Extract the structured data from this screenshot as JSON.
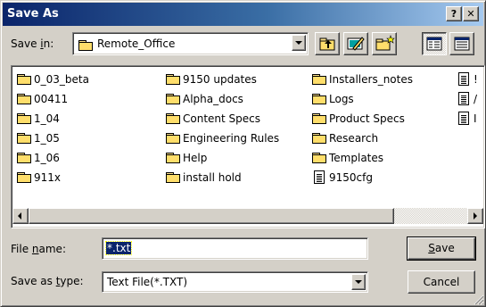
{
  "window": {
    "title": "Save As"
  },
  "titlebar": {
    "help_label": "?",
    "close_label": "✕"
  },
  "save_in": {
    "label_pre": "Save ",
    "label_key": "i",
    "label_post": "n:",
    "value": "Remote_Office"
  },
  "toolbar": {
    "up_folder_icon": "up-one-level-icon",
    "desktop_icon": "desktop-icon",
    "new_folder_icon": "new-folder-icon",
    "list_view_icon": "list-view-icon",
    "details_view_icon": "details-view-icon"
  },
  "files": {
    "col1": [
      {
        "name": "0_03_beta",
        "icon": "folder"
      },
      {
        "name": "00411",
        "icon": "folder"
      },
      {
        "name": "1_04",
        "icon": "folder"
      },
      {
        "name": "1_05",
        "icon": "folder"
      },
      {
        "name": "1_06",
        "icon": "folder"
      },
      {
        "name": "911x",
        "icon": "folder"
      }
    ],
    "col2": [
      {
        "name": "9150 updates",
        "icon": "folder"
      },
      {
        "name": "Alpha_docs",
        "icon": "folder"
      },
      {
        "name": "Content Specs",
        "icon": "folder"
      },
      {
        "name": "Engineering Rules",
        "icon": "folder"
      },
      {
        "name": "Help",
        "icon": "folder"
      },
      {
        "name": "install hold",
        "icon": "folder"
      }
    ],
    "col3": [
      {
        "name": "Installers_notes",
        "icon": "folder"
      },
      {
        "name": "Logs",
        "icon": "folder"
      },
      {
        "name": "Product Specs",
        "icon": "folder"
      },
      {
        "name": "Research",
        "icon": "folder"
      },
      {
        "name": "Templates",
        "icon": "folder"
      },
      {
        "name": "9150cfg",
        "icon": "file"
      }
    ],
    "col4_partial": [
      {
        "name": "!",
        "icon": "file"
      },
      {
        "name": "/",
        "icon": "file"
      },
      {
        "name": "I",
        "icon": "file"
      }
    ]
  },
  "file_name": {
    "label_pre": "File ",
    "label_key": "n",
    "label_post": "ame:",
    "value": "*.txt"
  },
  "save_as_type": {
    "label_pre": "Save as ",
    "label_key": "t",
    "label_post": "ype:",
    "value": "Text File(*.TXT)"
  },
  "buttons": {
    "save_key": "S",
    "save_rest": "ave",
    "cancel": "Cancel"
  }
}
